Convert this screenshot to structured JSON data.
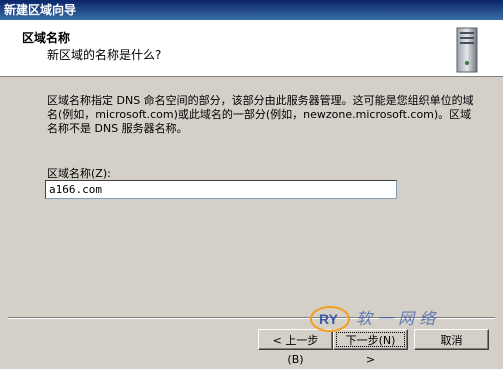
{
  "window": {
    "title": "新建区域向导"
  },
  "header": {
    "title": "区域名称",
    "subtitle": "新区域的名称是什么?"
  },
  "body": {
    "description": "区域名称指定 DNS 命名空间的部分，该部分由此服务器管理。这可能是您组织单位的域名(例如，microsoft.com)或此域名的一部分(例如，newzone.microsoft.com)。区域名称不是 DNS 服务器名称。",
    "zone_name_label": "区域名称(Z):",
    "zone_name_value": "a166.com"
  },
  "buttons": {
    "back": "< 上一步(B)",
    "next": "下一步(N) >",
    "cancel": "取消"
  },
  "watermark": {
    "text": "软 一 网 络",
    "logo": "RY"
  },
  "icons": {
    "server": "server-icon"
  },
  "colors": {
    "titlebar": "#0a246a",
    "header_bg": "#ffffff",
    "dialog_bg": "#d4d0c8"
  }
}
